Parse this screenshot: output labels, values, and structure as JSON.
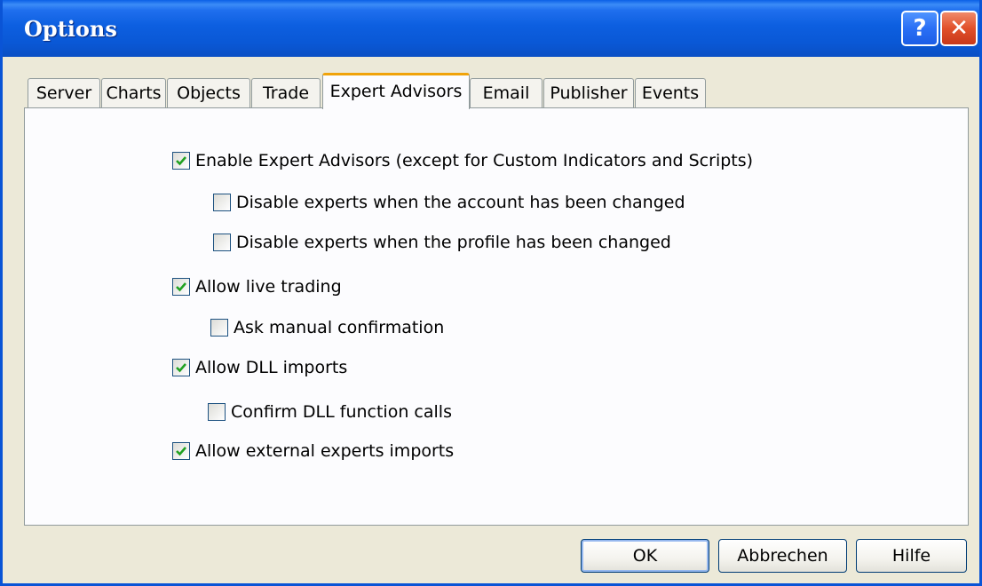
{
  "window": {
    "title": "Options",
    "help_label": "?",
    "close_label": "✕"
  },
  "tabs": [
    {
      "label": "Server",
      "active": false
    },
    {
      "label": "Charts",
      "active": false
    },
    {
      "label": "Objects",
      "active": false
    },
    {
      "label": "Trade",
      "active": false
    },
    {
      "label": "Expert Advisors",
      "active": true
    },
    {
      "label": "Email",
      "active": false
    },
    {
      "label": "Publisher",
      "active": false
    },
    {
      "label": "Events",
      "active": false
    }
  ],
  "options": [
    {
      "label": "Enable Expert Advisors (except for Custom Indicators and Scripts)",
      "checked": true
    },
    {
      "label": "Disable experts when the account has been changed",
      "checked": false
    },
    {
      "label": "Disable experts when the profile has been changed",
      "checked": false
    },
    {
      "label": "Allow live trading",
      "checked": true
    },
    {
      "label": "Ask manual confirmation",
      "checked": false
    },
    {
      "label": "Allow DLL imports",
      "checked": true
    },
    {
      "label": "Confirm DLL function calls",
      "checked": false
    },
    {
      "label": "Allow external experts imports",
      "checked": true
    }
  ],
  "buttons": {
    "ok_label": "OK",
    "cancel_label": "Abbrechen",
    "help_label": "Hilfe"
  },
  "colors": {
    "titlebar": "#0a58d6",
    "active_tab_accent": "#f0a30a",
    "checkmark": "#21a121"
  }
}
